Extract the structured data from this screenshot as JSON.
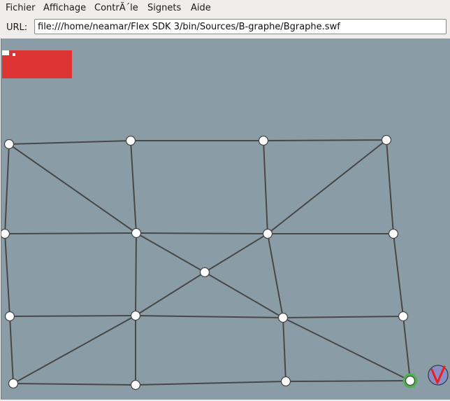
{
  "menu": {
    "items": [
      "Fichier",
      "Affichage",
      "ContrÃ´le",
      "Signets",
      "Aide"
    ]
  },
  "address": {
    "label": "URL:",
    "value": "file:///home/neamar/Flex SDK 3/bin/Sources/B-graphe/Bgraphe.swf"
  },
  "colors": {
    "stage_background": "#8a9da7",
    "red_bar": "#dd3333",
    "edge": "#474747",
    "node_fill": "#ffffff",
    "target_ring": "#4fb04f",
    "validate_button": "#8a8ec8",
    "validate_glyph": "#ee1e1e"
  },
  "validate_button": {
    "glyph": "V",
    "icon": "checkmark-v-icon"
  }
}
